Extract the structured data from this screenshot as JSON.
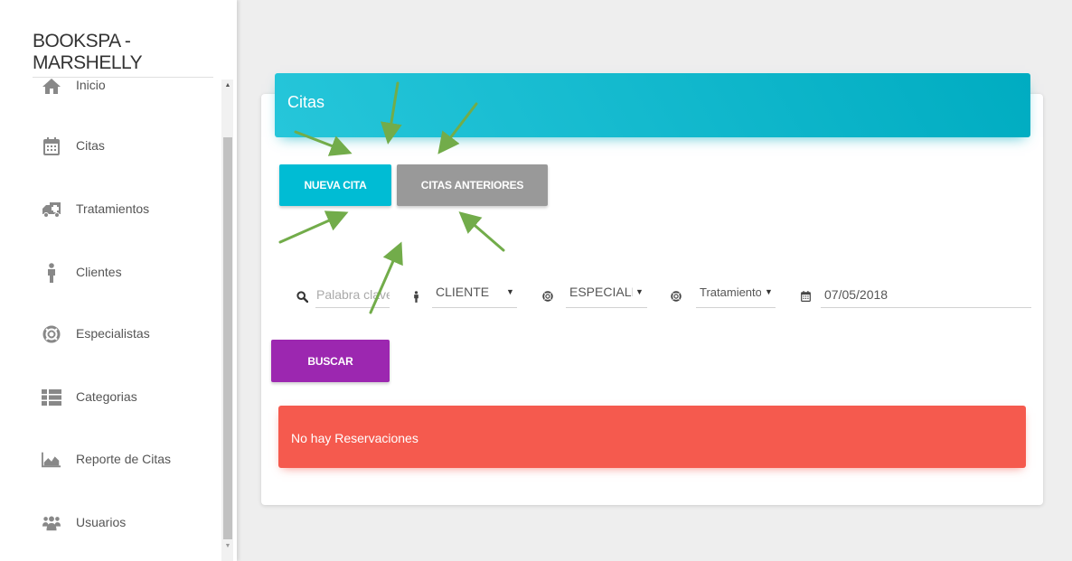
{
  "sidebar": {
    "brand": "BOOKSPA - MARSHELLY",
    "items": [
      {
        "label": "Inicio",
        "icon": "home-icon"
      },
      {
        "label": "Citas",
        "icon": "calendar-icon"
      },
      {
        "label": "Tratamientos",
        "icon": "ambulance-icon"
      },
      {
        "label": "Clientes",
        "icon": "person-icon"
      },
      {
        "label": "Especialistas",
        "icon": "lifebuoy-icon"
      },
      {
        "label": "Categorias",
        "icon": "list-icon"
      },
      {
        "label": "Reporte de Citas",
        "icon": "area-chart-icon"
      },
      {
        "label": "Usuarios",
        "icon": "users-icon"
      }
    ]
  },
  "card": {
    "title": "Citas",
    "new_label": "NUEVA CITA",
    "previous_label": "CITAS ANTERIORES",
    "search_label": "BUSCAR"
  },
  "filters": {
    "keyword_placeholder": "Palabra clave",
    "keyword_value": "",
    "client_selected": "CLIENTE",
    "specialist_selected": "ESPECIALI",
    "treatment_selected": "Tratamiento",
    "date_value": "07/05/2018"
  },
  "alert": {
    "text": "No hay Reservaciones"
  },
  "colors": {
    "header": "#00acc1",
    "new_button": "#00bcd4",
    "previous_button": "#999999",
    "search_button": "#9c27b0",
    "alert": "#f55a4e",
    "annotation_arrows": "#72ac4a"
  }
}
